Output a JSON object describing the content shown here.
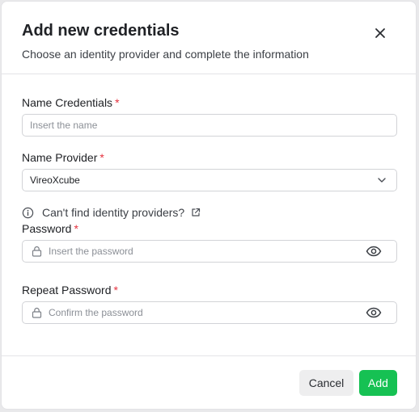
{
  "dialog": {
    "title": "Add new credentials",
    "subtitle": "Choose an identity provider and complete the information",
    "close_icon": "close-icon"
  },
  "form": {
    "name_credentials": {
      "label": "Name Credentials",
      "required_mark": "*",
      "placeholder": "Insert the name",
      "value": ""
    },
    "name_provider": {
      "label": "Name Provider",
      "required_mark": "*",
      "selected": "VireoXcube",
      "icon": "chevron-down-icon"
    },
    "provider_hint": {
      "text": "Can't find identity providers?",
      "info_icon": "info-icon",
      "link_icon": "external-link-icon"
    },
    "password": {
      "label": "Password",
      "required_mark": "*",
      "placeholder": "Insert the password",
      "lock_icon": "lock-icon",
      "toggle_icon": "eye-icon"
    },
    "repeat_password": {
      "label": "Repeat Password",
      "required_mark": "*",
      "placeholder": "Confirm the password",
      "lock_icon": "lock-icon",
      "toggle_icon": "eye-icon"
    }
  },
  "footer": {
    "cancel_label": "Cancel",
    "add_label": "Add"
  },
  "colors": {
    "accent": "#16c153",
    "required": "#e5323f",
    "border": "#d2d3d7",
    "cancel_bg": "#eeeeef"
  }
}
